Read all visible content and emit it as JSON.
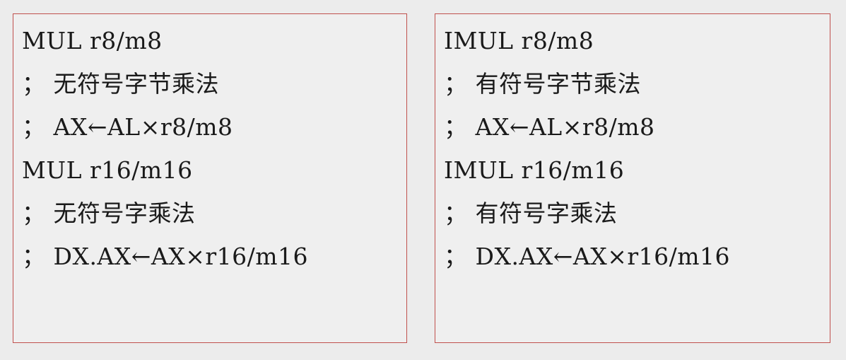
{
  "left_panel": {
    "lines": [
      "MUL r8/m8",
      "； 无符号字节乘法",
      "； AX←AL×r8/m8",
      "MUL r16/m16",
      "； 无符号字乘法",
      "； DX.AX←AX×r16/m16"
    ]
  },
  "right_panel": {
    "lines": [
      "IMUL r8/m8",
      "； 有符号字节乘法",
      "； AX←AL×r8/m8",
      "IMUL r16/m16",
      "； 有符号字乘法",
      "； DX.AX←AX×r16/m16"
    ]
  }
}
